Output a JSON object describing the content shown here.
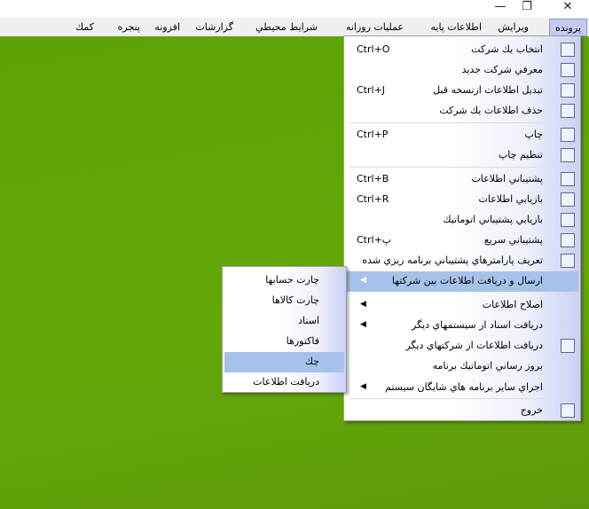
{
  "window": {
    "controls": [
      {
        "name": "minimize",
        "glyph": "—"
      },
      {
        "name": "restore",
        "glyph": "❐"
      },
      {
        "name": "close",
        "glyph": "✕"
      }
    ]
  },
  "menubar": {
    "items": [
      "پرونده",
      "ويرايش",
      "اطلاعات پايه",
      "عمليات روزانه",
      "شرايط محيطي",
      "گزارشات",
      "افزونه",
      "پنجره",
      "كمك"
    ],
    "active": "پرونده"
  },
  "file_menu": {
    "items": [
      {
        "label": "انتخاب يك شركت",
        "shortcut": "Ctrl+O",
        "icon": "grid-icon"
      },
      {
        "label": "معرفي شركت جديد",
        "shortcut": "",
        "icon": "new-document-icon"
      },
      {
        "label": "تبديل اطلاعات ازنسخه قبل",
        "shortcut": "Ctrl+J",
        "icon": "console-icon"
      },
      {
        "label": "حذف اطلاعات يك شركت",
        "shortcut": "",
        "icon": "delete-document-icon"
      },
      {
        "label": "چاپ",
        "shortcut": "Ctrl+P",
        "icon": "printer-icon"
      },
      {
        "label": "تنظيم چاپ",
        "shortcut": "",
        "icon": "print-setup-icon"
      },
      {
        "label": "پشتيباني اطلاعات",
        "shortcut": "Ctrl+B",
        "icon": "backup-icon"
      },
      {
        "label": "بازيابي اطلاعات",
        "shortcut": "Ctrl+R",
        "icon": "restore-icon"
      },
      {
        "label": "بازيابي پشتيباني اتوماتيك",
        "shortcut": "",
        "icon": "clock-icon"
      },
      {
        "label": "پشتيباني سريع",
        "shortcut": "Ctrl+پ",
        "icon": "quick-backup-icon"
      },
      {
        "label": "تعريف پارامترهاي پشتيباني برنامه ريزي شده",
        "shortcut": "",
        "icon": "schedule-icon"
      },
      {
        "label": "ارسال و دريافت اطلاعات بين شركتها",
        "submenu": true,
        "highlighted": true
      },
      {
        "label": "اصلاح اطلاعات",
        "submenu": true
      },
      {
        "label": "دريافت اسناد از سيستمهاي ديگر",
        "submenu": true
      },
      {
        "label": "دريافت اطلاعات از شركتهاي ديگر",
        "shortcut": "",
        "icon": "excel-icon"
      },
      {
        "label": "بروز رساني اتوماتيك برنامه",
        "shortcut": ""
      },
      {
        "label": "اجراي ساير برنامه هاي شايگان سيستم",
        "submenu": true
      },
      {
        "label": "خروج",
        "shortcut": "",
        "icon": "exit-door-icon"
      }
    ]
  },
  "submenu": {
    "items": [
      "چارت حسابها",
      "چارت كالاها",
      "اسناد",
      "فاكتورها",
      "چك",
      "دريافت اطلاعات"
    ],
    "highlighted": "چك"
  },
  "colors": {
    "desktop": "#5ca303",
    "highlight": "#a7c2ea",
    "menubar_active": "#c3ccee"
  }
}
